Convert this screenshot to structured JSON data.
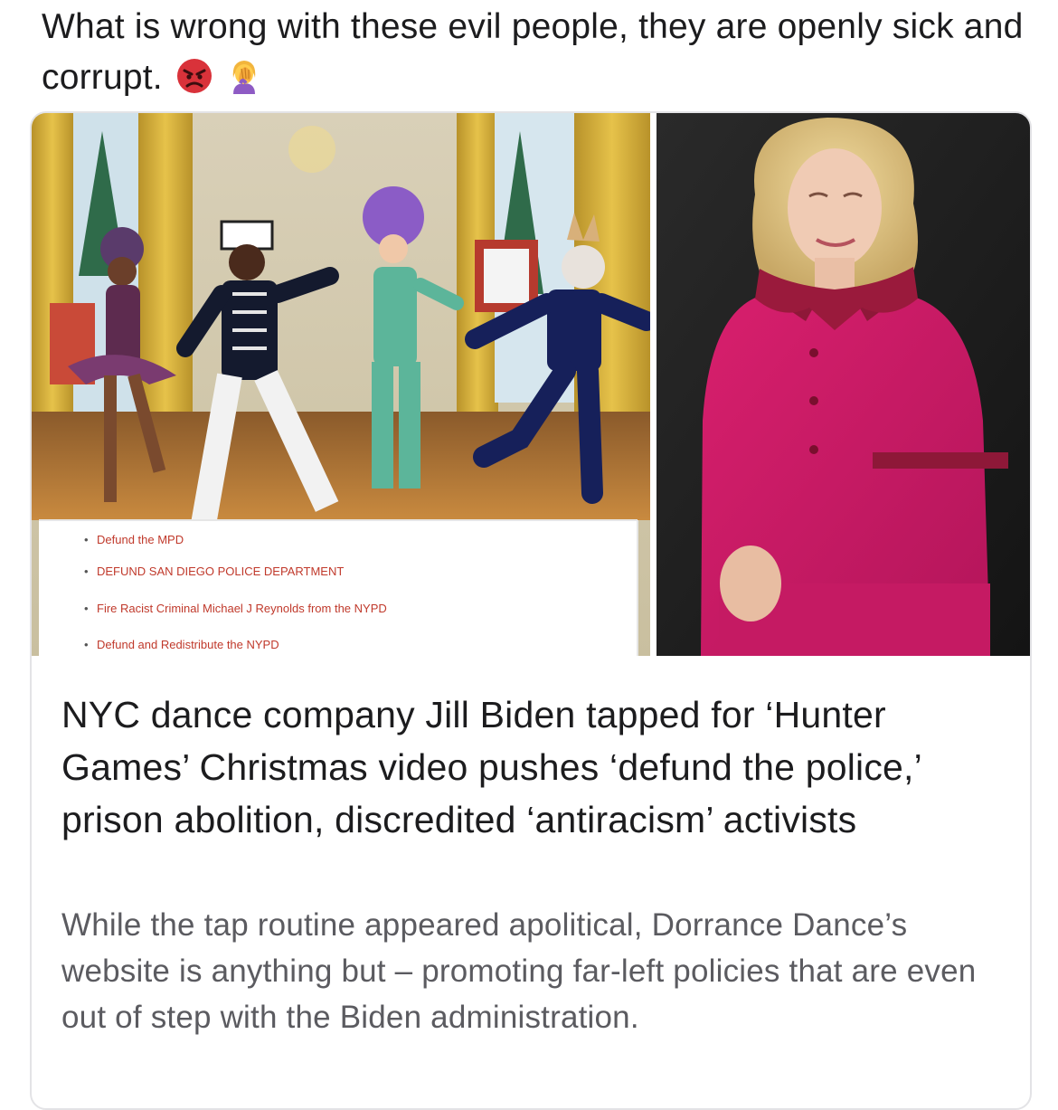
{
  "post": {
    "text": "What is wrong with these evil people, they are openly sick and corrupt.",
    "emojis": [
      "angry-face-icon",
      "woman-facepalming-icon"
    ]
  },
  "link_card": {
    "left_image": {
      "list_items": [
        "Defund the MPD",
        "DEFUND SAN DIEGO POLICE DEPARTMENT",
        "Fire Racist Criminal Michael J Reynolds from the NYPD",
        "Defund and Redistribute the NYPD"
      ]
    },
    "title": "NYC dance company Jill Biden tapped for ‘Hunter Games’ Christmas video pushes ‘defund the police,’ prison abolition, discredited ‘antiracism’ activists",
    "description": "While the tap routine appeared apolitical, Dorrance Dance’s website is anything but – promoting far-left policies that are even out of step with the Biden administration."
  },
  "colors": {
    "text": "#1c1c1e",
    "description": "#5b5b60",
    "card_border": "#e3e3e6",
    "list_text": "#c0392b"
  }
}
